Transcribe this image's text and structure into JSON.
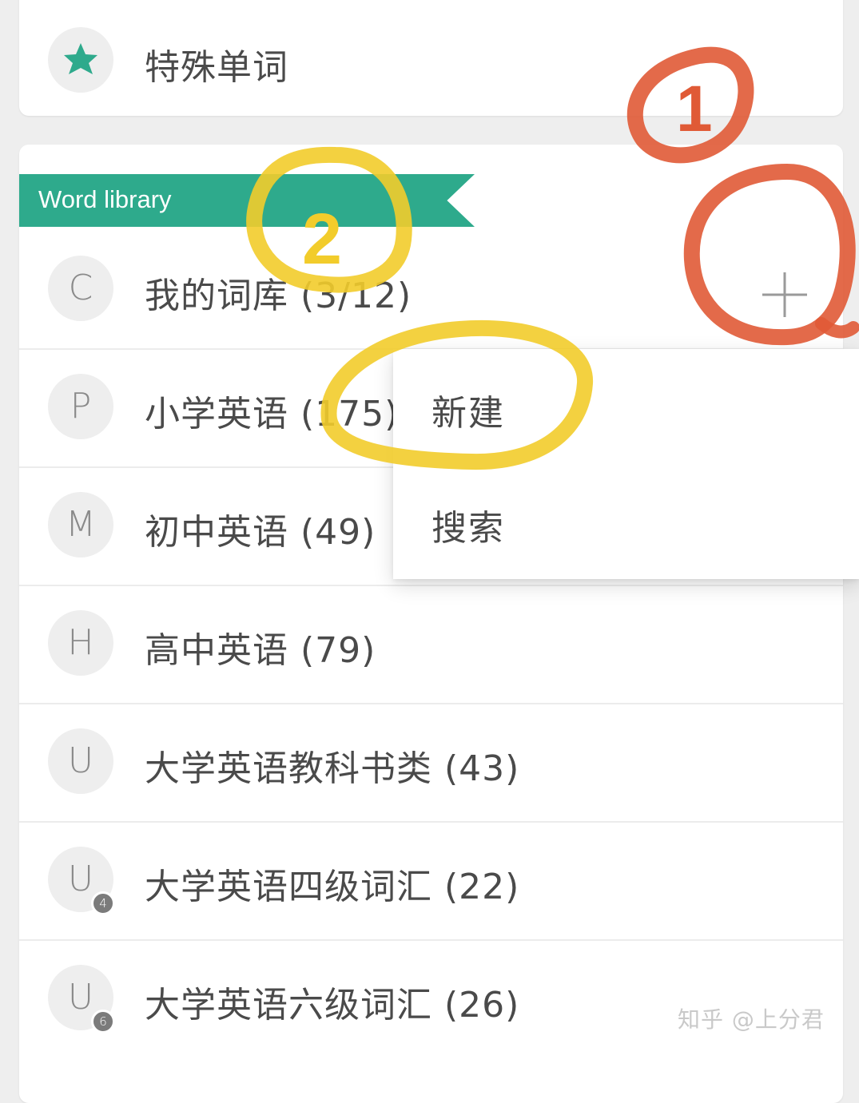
{
  "special_words": {
    "icon": "star-icon",
    "label": "特殊单词",
    "accent_color": "#2eaa8c"
  },
  "library": {
    "ribbon_label": "Word library",
    "add_icon": "plus-icon",
    "items": [
      {
        "letter": "C",
        "label": "我的词库 (3/12)"
      },
      {
        "letter": "P",
        "label": "小学英语 (175)"
      },
      {
        "letter": "M",
        "label": "初中英语 (49)"
      },
      {
        "letter": "H",
        "label": "高中英语 (79)"
      },
      {
        "letter": "U",
        "label": "大学英语教科书类 (43)"
      },
      {
        "letter": "U",
        "sub": "4",
        "label": "大学英语四级词汇 (22)"
      },
      {
        "letter": "U",
        "sub": "6",
        "label": "大学英语六级词汇 (26)"
      }
    ]
  },
  "popup_menu": {
    "items": [
      {
        "label": "新建"
      },
      {
        "label": "搜索"
      }
    ]
  },
  "annotations": {
    "marker_1": "1",
    "marker_2": "2",
    "colors": {
      "red": "#e05a36",
      "yellow": "#f2cc2b"
    }
  },
  "watermark": "知乎 @上分君"
}
